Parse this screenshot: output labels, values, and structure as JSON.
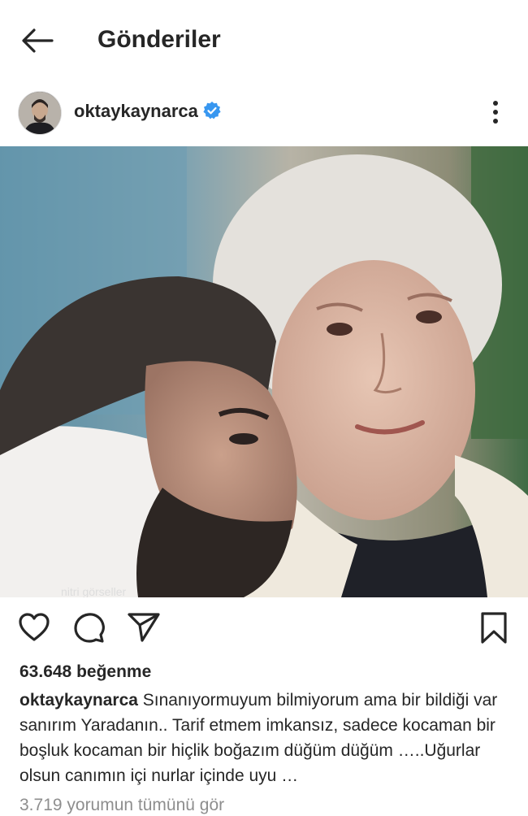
{
  "header": {
    "title": "Gönderiler"
  },
  "post": {
    "username": "oktaykaynarca",
    "verified": true,
    "likes": "63.648 beğenme",
    "caption_user": "oktaykaynarca",
    "caption_text": "Sınanıyormuyum bilmiyorum ama bir bildiği var sanırım Yaradanın.. Tarif etmem imkansız, sadece kocaman bir boşluk kocaman bir hiçlik boğazım düğüm düğüm …..Uğurlar olsun canımın içi nurlar içinde uyu …",
    "comments_link": "3.719 yorumun tümünü gör",
    "photo_watermark": "nitri görseller"
  },
  "icons": {
    "back": "arrow-left-icon",
    "verified": "verified-badge-icon",
    "more": "more-vertical-icon",
    "like": "heart-icon",
    "comment": "comment-icon",
    "share": "send-icon",
    "save": "bookmark-icon"
  },
  "colors": {
    "text": "#262626",
    "muted": "#8e8e8e",
    "verified_blue": "#3897f0"
  }
}
